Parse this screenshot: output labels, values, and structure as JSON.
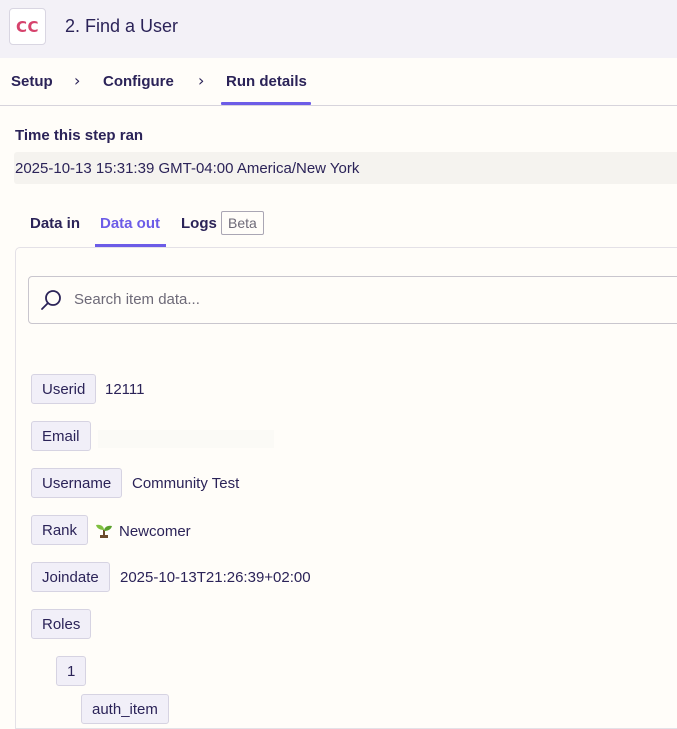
{
  "header": {
    "app_logo_text": "CC",
    "step_title": "2. Find a User"
  },
  "top_tabs": [
    {
      "label": "Setup"
    },
    {
      "label": "Configure"
    },
    {
      "label": "Run details",
      "active": true
    }
  ],
  "time_section": {
    "label": "Time this step ran",
    "value": "2025-10-13 15:31:39 GMT-04:00 America/New York"
  },
  "sub_tabs": [
    {
      "label": "Data in"
    },
    {
      "label": "Data out",
      "active": true
    },
    {
      "label": "Logs"
    }
  ],
  "beta_badge": "Beta",
  "search": {
    "placeholder": "Search item data..."
  },
  "fields": {
    "userid": {
      "key": "Userid",
      "value": "12111"
    },
    "email": {
      "key": "Email",
      "value": ""
    },
    "username": {
      "key": "Username",
      "value": "Community Test"
    },
    "rank": {
      "key": "Rank",
      "value": "Newcomer",
      "icon": "seedling-icon"
    },
    "joindate": {
      "key": "Joindate",
      "value": "2025-10-13T21:26:39+02:00"
    },
    "roles": {
      "key": "Roles"
    },
    "roles_index": {
      "key": "1"
    },
    "auth_item": {
      "key": "auth_item"
    }
  },
  "colors": {
    "accent": "#6c5ce7",
    "logo_text": "#d6426c",
    "text": "#2b2358",
    "header_bg": "#f3f1f7",
    "page_bg": "#fffdf9"
  }
}
